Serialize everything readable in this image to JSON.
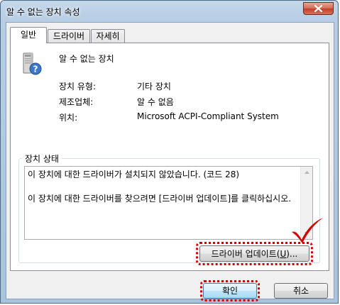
{
  "window": {
    "title": "알 수 없는 장치 속성",
    "close_icon": "close-icon"
  },
  "tabs": [
    {
      "label": "일반",
      "active": true
    },
    {
      "label": "드라이버",
      "active": false
    },
    {
      "label": "자세히",
      "active": false
    }
  ],
  "device": {
    "name": "알 수 없는 장치",
    "icon": "unknown-device-icon"
  },
  "properties": [
    {
      "label": "장치 유형:",
      "value": "기타 장치"
    },
    {
      "label": "제조업체:",
      "value": "알 수 없음"
    },
    {
      "label": "위치:",
      "value": "Microsoft ACPI-Compliant System"
    }
  ],
  "status": {
    "group_title": "장치 상태",
    "text": "이 장치에 대한 드라이버가 설치되지 않았습니다. (코드 28)\n\n이 장치에 대한 드라이버를 찾으려면 [드라이버 업데이트]를 클릭하십시오.",
    "update_button": {
      "label_prefix": "드라이버 업데이트(",
      "accel": "U",
      "label_suffix": ")..."
    }
  },
  "footer": {
    "ok_label": "확인",
    "cancel_label": "취소"
  },
  "annotation": {
    "highlight_color": "#d40000"
  }
}
